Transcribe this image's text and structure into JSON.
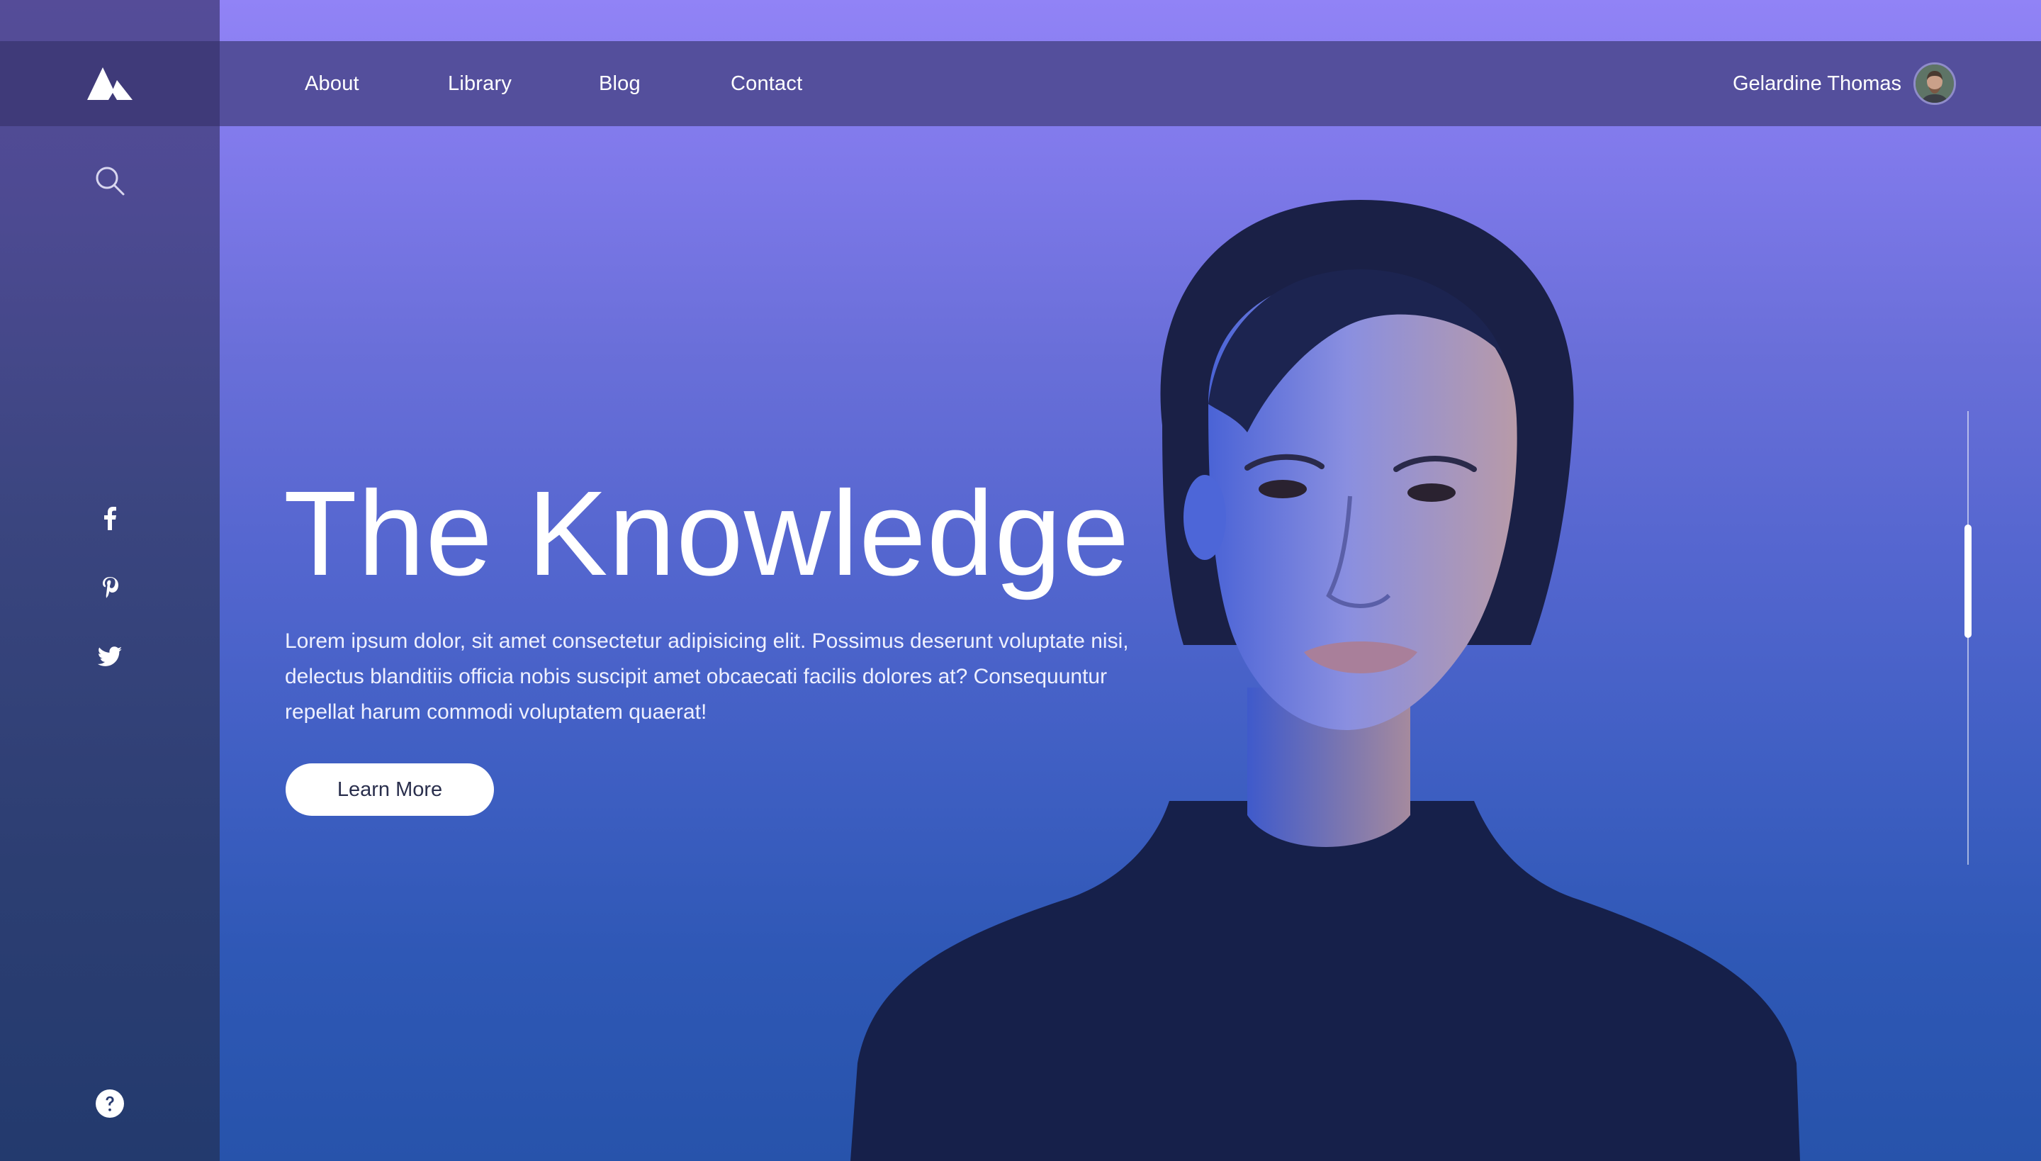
{
  "colors": {
    "sidebar": "#3b4581",
    "topnav": "#544f9c",
    "hero_top": "#9183f6",
    "hero_bottom": "#2753ab",
    "cta_bg": "#ffffff",
    "cta_text": "#2a2f4d"
  },
  "brand": {
    "logo_icon": "mountain-logo-icon"
  },
  "nav": {
    "links": [
      "About",
      "Library",
      "Blog",
      "Contact"
    ],
    "user_name": "Gelardine Thomas",
    "avatar_icon": "user-avatar"
  },
  "sidebar": {
    "search_icon": "search-icon",
    "social_icons": [
      "facebook-icon",
      "pinterest-icon",
      "twitter-icon"
    ],
    "help_icon": "help-icon"
  },
  "hero": {
    "title": "The Knowledge",
    "body": "Lorem ipsum dolor, sit amet consectetur adipisicing elit. Possimus deserunt voluptate nisi, delectus blanditiis officia nobis suscipit amet obcaecati facilis dolores at? Consequuntur repellat harum commodi voluptatem quaerat!",
    "cta_label": "Learn More"
  },
  "scroll_indicator": {
    "position_fraction": 0.27
  }
}
